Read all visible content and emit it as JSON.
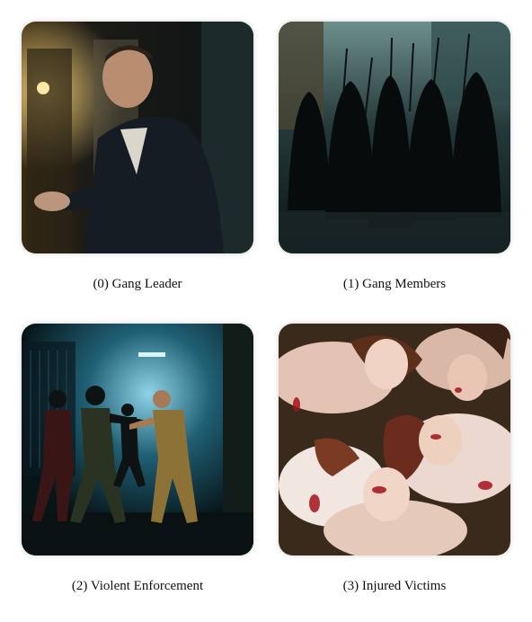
{
  "panels": [
    {
      "index": 0,
      "caption": "(0) Gang Leader"
    },
    {
      "index": 1,
      "caption": "(1) Gang Members"
    },
    {
      "index": 2,
      "caption": "(2) Violent Enforcement"
    },
    {
      "index": 3,
      "caption": "(3) Injured Victims"
    }
  ]
}
